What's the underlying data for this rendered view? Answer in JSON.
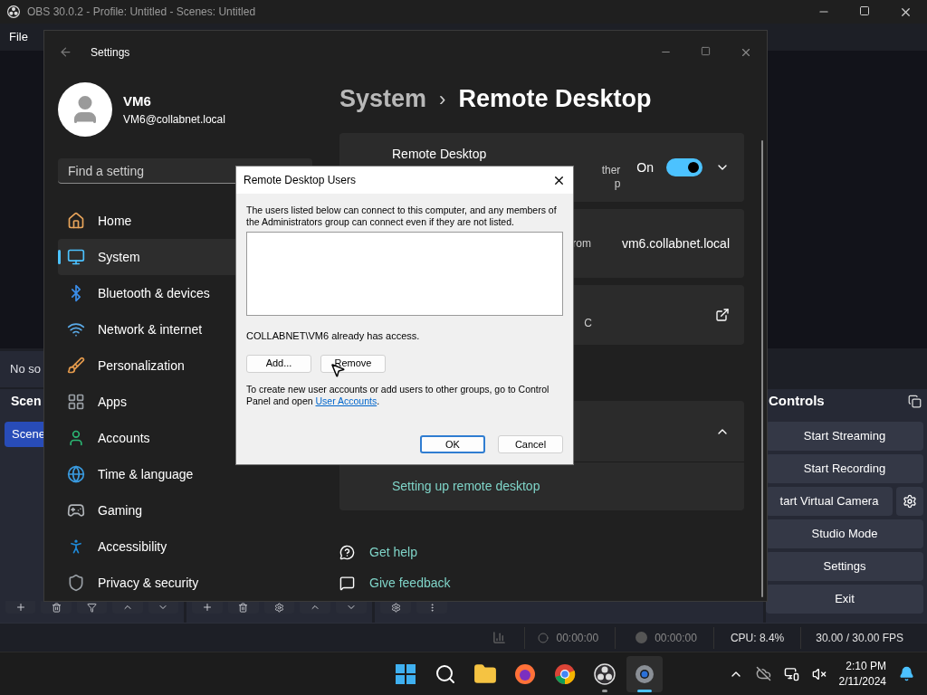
{
  "obs": {
    "title": "OBS 30.0.2 - Profile: Untitled - Scenes: Untitled",
    "menu": [
      "File"
    ],
    "context_bar": "No so",
    "scenes": {
      "header": "Scen",
      "items": [
        {
          "label": "Scene",
          "selected": true
        }
      ]
    },
    "controls": {
      "header": "Controls",
      "buttons": [
        {
          "label": "Start Streaming",
          "kind": "plain"
        },
        {
          "label": "Start Recording",
          "kind": "plain"
        },
        {
          "label": "tart Virtual Camera",
          "kind": "with_gear"
        },
        {
          "label": "Studio Mode",
          "kind": "plain"
        },
        {
          "label": "Settings",
          "kind": "plain"
        },
        {
          "label": "Exit",
          "kind": "plain"
        }
      ]
    },
    "status": {
      "stream_time": "00:00:00",
      "record_time": "00:00:00",
      "cpu": "CPU: 8.4%",
      "fps": "30.00 / 30.00 FPS"
    }
  },
  "settings": {
    "title": "Settings",
    "user": {
      "name": "VM6",
      "email": "VM6@collabnet.local"
    },
    "search": {
      "placeholder": "Find a setting"
    },
    "nav": [
      {
        "label": "Home",
        "kind": "home",
        "selected": false
      },
      {
        "label": "System",
        "kind": "system",
        "selected": true
      },
      {
        "label": "Bluetooth & devices",
        "kind": "bluetooth",
        "selected": false
      },
      {
        "label": "Network & internet",
        "kind": "network",
        "selected": false
      },
      {
        "label": "Personalization",
        "kind": "personalization",
        "selected": false
      },
      {
        "label": "Apps",
        "kind": "apps",
        "selected": false
      },
      {
        "label": "Accounts",
        "kind": "accounts",
        "selected": false
      },
      {
        "label": "Time & language",
        "kind": "time",
        "selected": false
      },
      {
        "label": "Gaming",
        "kind": "gaming",
        "selected": false
      },
      {
        "label": "Accessibility",
        "kind": "accessibility",
        "selected": false
      },
      {
        "label": "Privacy & security",
        "kind": "privacy",
        "selected": false
      }
    ],
    "breadcrumb": {
      "parent": "System",
      "separator": "›",
      "current": "Remote Desktop"
    },
    "cards": [
      {
        "kind": "toggle",
        "title": "Remote Desktop",
        "fragments": [
          "ther",
          "p"
        ],
        "toggle_label": "On",
        "on": true,
        "expanded": false
      },
      {
        "kind": "value",
        "fragments": [
          "rom"
        ],
        "value": "vm6.collabnet.local"
      },
      {
        "kind": "external",
        "fragments": [
          "C"
        ]
      },
      {
        "kind": "section",
        "expanded": true,
        "link": "Setting up remote desktop"
      }
    ],
    "help_links": [
      {
        "label": "Get help",
        "kind": "help"
      },
      {
        "label": "Give feedback",
        "kind": "feedback"
      }
    ]
  },
  "dialog": {
    "title": "Remote Desktop Users",
    "intro": "The users listed below can connect to this computer, and any members of the Administrators group can connect even if they are not listed.",
    "access_note": "COLLABNET\\VM6 already has access.",
    "buttons": [
      "Add...",
      "Remove"
    ],
    "footer": "To create new user accounts or add users to other groups, go to Control Panel and open ",
    "footer_link": "User Accounts",
    "footer_end": ".",
    "ok": "OK",
    "cancel": "Cancel"
  },
  "taskbar": {
    "apps": [
      {
        "kind": "start",
        "running": false,
        "selected": false
      },
      {
        "kind": "search",
        "running": false,
        "selected": false
      },
      {
        "kind": "files",
        "running": false,
        "selected": false
      },
      {
        "kind": "firefox",
        "running": false,
        "selected": false
      },
      {
        "kind": "chrome",
        "running": false,
        "selected": false
      },
      {
        "kind": "obs",
        "running": true,
        "selected": false
      },
      {
        "kind": "settings",
        "running": true,
        "selected": true
      }
    ],
    "time": "2:10 PM",
    "date": "2/11/2024"
  }
}
